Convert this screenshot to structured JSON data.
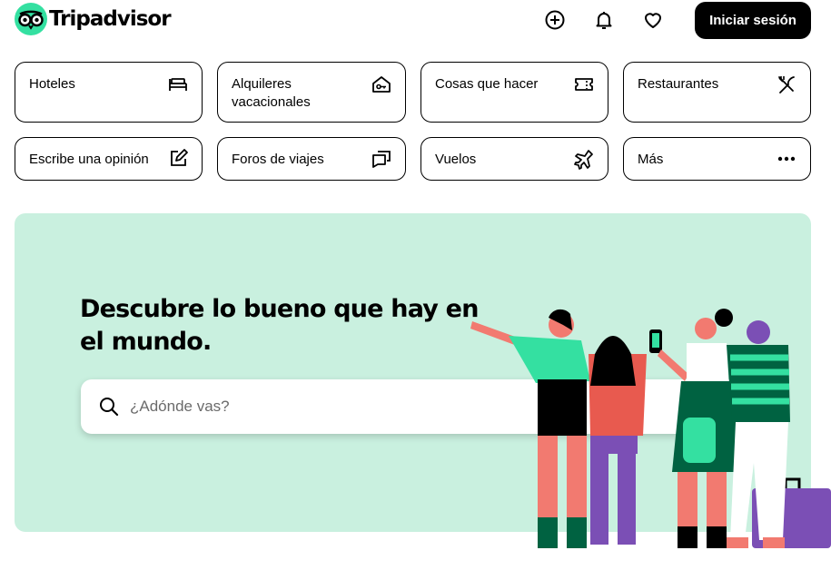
{
  "header": {
    "brand": "Tripadvisor",
    "icons": [
      "plus-circle-icon",
      "bell-icon",
      "heart-icon"
    ],
    "signin_label": "Iniciar sesión"
  },
  "categories": [
    {
      "label": "Hoteles",
      "icon": "bed-icon"
    },
    {
      "label": "Alquileres vacacionales",
      "icon": "house-key-icon"
    },
    {
      "label": "Cosas que hacer",
      "icon": "ticket-icon"
    },
    {
      "label": "Restaurantes",
      "icon": "fork-knife-icon"
    },
    {
      "label": "Escribe una opinión",
      "icon": "edit-icon"
    },
    {
      "label": "Foros de viajes",
      "icon": "chat-bubbles-icon"
    },
    {
      "label": "Vuelos",
      "icon": "plane-icon"
    },
    {
      "label": "Más",
      "icon": "more-dots-icon"
    }
  ],
  "hero": {
    "title": "Descubre lo bueno que hay en el mundo.",
    "search_placeholder": "¿Adónde vas?"
  },
  "colors": {
    "brand_green": "#34E0A1",
    "hero_bg": "#C9F0DF",
    "button_bg": "#000000"
  }
}
